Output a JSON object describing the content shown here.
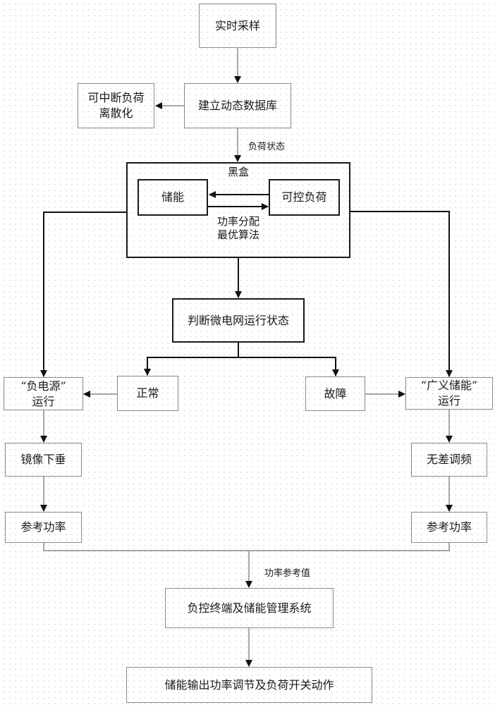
{
  "diagram": {
    "nodes": {
      "realtime_sampling": "实时采样",
      "build_database": "建立动态数据库",
      "interruptible_load": [
        "可中断负荷",
        "离散化"
      ],
      "black_box_title": "黑盒",
      "energy_storage": "储能",
      "controllable_load": "可控负荷",
      "algorithm": [
        "功率分配",
        "最优算法"
      ],
      "judge_state": "判断微电网运行状态",
      "normal": "正常",
      "fault": "故障",
      "negative_power": [
        "“负电源”",
        "运行"
      ],
      "generalized_storage": [
        "“广义储能”",
        "运行"
      ],
      "mirror_droop": "镜像下垂",
      "zero_error_freq": "无差调频",
      "ref_power_left": "参考功率",
      "ref_power_right": "参考功率",
      "management_system": "负控终端及储能管理系统",
      "final_action": "储能输出功率调节及负荷开关动作"
    },
    "edge_labels": {
      "load_state": "负荷状态",
      "power_reference": "功率参考值"
    }
  }
}
